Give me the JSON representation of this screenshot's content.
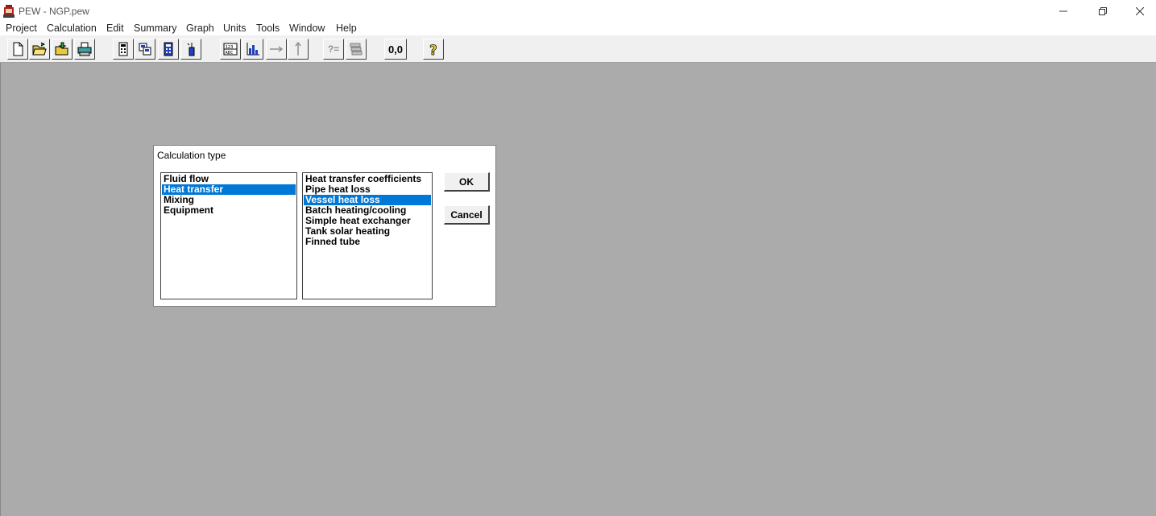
{
  "window": {
    "title": "PEW - NGP.pew",
    "controls": {
      "minimize": "minimize-icon",
      "restore": "restore-icon",
      "close": "close-icon"
    }
  },
  "menu": [
    "Project",
    "Calculation",
    "Edit",
    "Summary",
    "Graph",
    "Units",
    "Tools",
    "Window",
    "Help"
  ],
  "toolbar": {
    "icons": [
      "new-file-icon",
      "open-folder-icon",
      "open-project-icon",
      "print-icon",
      "calculator-icon",
      "copy-icon",
      "calculator-blue-icon",
      "fluid-icon",
      "abc-table-icon",
      "bar-chart-icon",
      "arrow-right-icon",
      "arrow-up-icon",
      "query-icon",
      "stack-icon",
      "coordinate-icon",
      "help-icon"
    ],
    "query_label": "?=",
    "coord_label": "0,0"
  },
  "dialog": {
    "title": "Calculation type",
    "categories": [
      "Fluid flow",
      "Heat transfer",
      "Mixing",
      "Equipment"
    ],
    "selected_category": "Heat transfer",
    "calculations": [
      "Heat transfer coefficients",
      "Pipe heat loss",
      "Vessel heat loss",
      "Batch heating/cooling",
      "Simple heat exchanger",
      "Tank solar heating",
      "Finned tube"
    ],
    "selected_calculation": "Vessel heat loss",
    "ok_label": "OK",
    "cancel_label": "Cancel"
  },
  "colors": {
    "selection": "#0078d7",
    "workspace": "#ababab"
  }
}
